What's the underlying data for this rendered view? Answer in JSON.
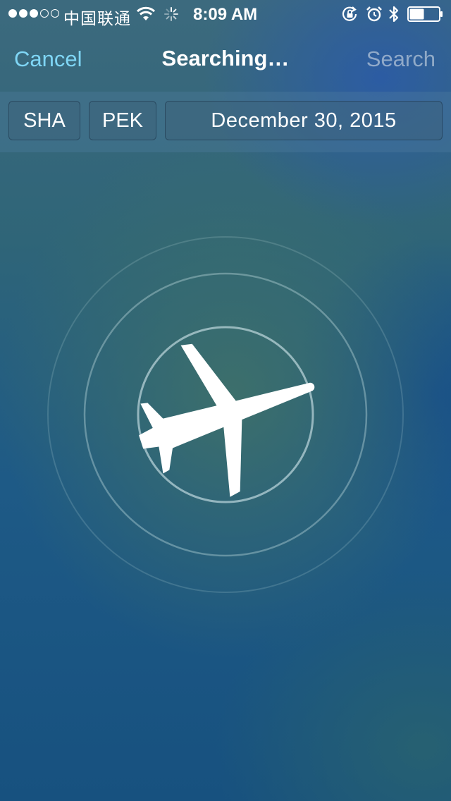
{
  "status_bar": {
    "carrier": "中国联通",
    "time": "8:09 AM",
    "signal_dots": [
      true,
      true,
      true,
      false,
      false
    ],
    "icons": [
      "wifi-icon",
      "activity-icon",
      "rotation-lock-icon",
      "alarm-icon",
      "bluetooth-icon",
      "battery-icon"
    ],
    "battery_level": 0.5
  },
  "nav": {
    "cancel_label": "Cancel",
    "title": "Searching…",
    "search_label": "Search"
  },
  "search": {
    "origin": "SHA",
    "destination": "PEK",
    "date": "December 30, 2015"
  },
  "radar": {
    "icon": "airplane-icon"
  },
  "colors": {
    "accent": "#7fd6f5",
    "text": "#ffffff",
    "disabled": "#aab8c4"
  }
}
